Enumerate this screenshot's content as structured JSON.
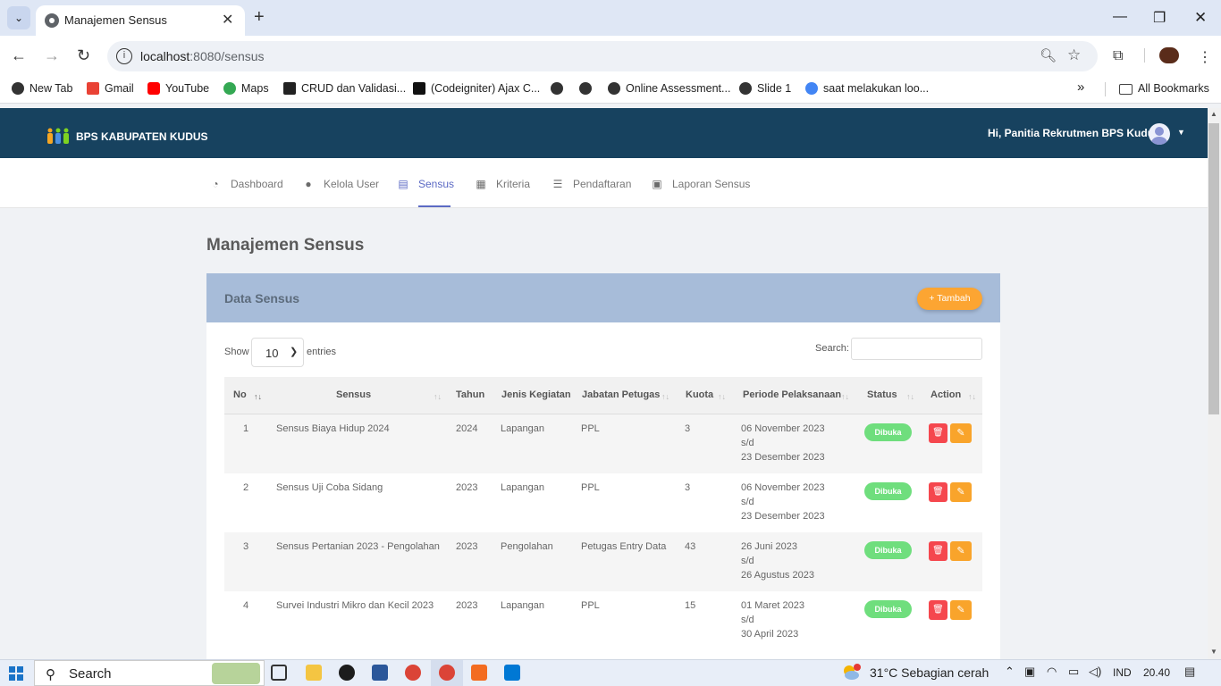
{
  "browser": {
    "tab_title": "Manajemen Sensus",
    "url_host": "localhost",
    "url_path": ":8080/sensus",
    "bookmarks": [
      "New Tab",
      "Gmail",
      "YouTube",
      "Maps",
      "CRUD dan Validasi...",
      "(Codeigniter) Ajax C...",
      "Online Assessment...",
      "Slide 1",
      "saat melakukan loo..."
    ],
    "all_bookmarks": "All Bookmarks",
    "more": "»"
  },
  "header": {
    "brand": "BPS KABUPATEN KUDUS",
    "greeting": "Hi, Panitia Rekrutmen BPS Kudus"
  },
  "menu": [
    {
      "label": "Dashboard",
      "icon": "dashboard-icon"
    },
    {
      "label": "Kelola User",
      "icon": "user-icon"
    },
    {
      "label": "Sensus",
      "icon": "clipboard-icon",
      "active": true
    },
    {
      "label": "Kriteria",
      "icon": "grid-icon"
    },
    {
      "label": "Pendaftaran",
      "icon": "checklist-icon"
    },
    {
      "label": "Laporan Sensus",
      "icon": "clipboard-check-icon"
    }
  ],
  "page": {
    "title": "Manajemen Sensus",
    "card_title": "Data Sensus",
    "add_label": "+ Tambah"
  },
  "table": {
    "show": "Show",
    "entries_value": "10",
    "entries": "entries",
    "search_label": "Search:",
    "columns": [
      "No",
      "Sensus",
      "Tahun",
      "Jenis Kegiatan",
      "Jabatan Petugas",
      "Kuota",
      "Periode Pelaksanaan",
      "Status",
      "Action"
    ],
    "rows": [
      {
        "no": "1",
        "sensus": "Sensus Biaya Hidup 2024",
        "tahun": "2024",
        "jenis": "Lapangan",
        "jabatan": "PPL",
        "kuota": "3",
        "p1": "06 November 2023",
        "p2": "s/d",
        "p3": "23 Desember 2023",
        "status": "Dibuka"
      },
      {
        "no": "2",
        "sensus": "Sensus Uji Coba Sidang",
        "tahun": "2023",
        "jenis": "Lapangan",
        "jabatan": "PPL",
        "kuota": "3",
        "p1": "06 November 2023",
        "p2": "s/d",
        "p3": "23 Desember 2023",
        "status": "Dibuka"
      },
      {
        "no": "3",
        "sensus": "Sensus Pertanian 2023 - Pengolahan",
        "tahun": "2023",
        "jenis": "Pengolahan",
        "jabatan": "Petugas Entry Data",
        "kuota": "43",
        "p1": "26 Juni 2023",
        "p2": "s/d",
        "p3": "26 Agustus 2023",
        "status": "Dibuka"
      },
      {
        "no": "4",
        "sensus": "Survei Industri Mikro dan Kecil 2023",
        "tahun": "2023",
        "jenis": "Lapangan",
        "jabatan": "PPL",
        "kuota": "15",
        "p1": "01 Maret 2023",
        "p2": "s/d",
        "p3": "30 April 2023",
        "status": "Dibuka"
      }
    ]
  },
  "taskbar": {
    "search": "Search",
    "temp": "31°C  Sebagian cerah",
    "lang": "IND",
    "time": "20.40"
  }
}
